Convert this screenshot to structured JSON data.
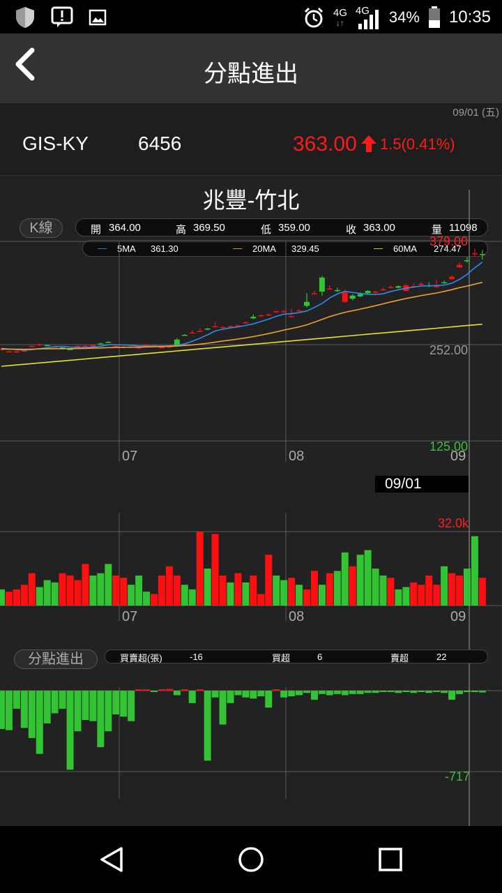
{
  "status_bar": {
    "network_1": "4G",
    "network_2": "4G",
    "battery": "34%",
    "time": "10:35",
    "icons": [
      "shield-icon",
      "alert-icon",
      "image-icon",
      "alarm-icon",
      "signal-icon",
      "battery-icon"
    ]
  },
  "header": {
    "title": "分點進出"
  },
  "quote": {
    "date": "09/01 (五)",
    "name": "GIS-KY",
    "code": "6456",
    "price": "363.00",
    "change": "1.5(0.41%)",
    "up_color": "#ff1a1a"
  },
  "broker": "兆豐-竹北",
  "kline": {
    "tag": "K線",
    "open_label": "開",
    "open": "364.00",
    "high_label": "高",
    "high": "369.50",
    "low_label": "低",
    "low": "359.00",
    "close_label": "收",
    "close": "363.00",
    "vol_label": "量",
    "vol": "11098",
    "ma5_label": "5MA",
    "ma5": "361.30",
    "ma5_color": "#2b8cf0",
    "ma20_label": "20MA",
    "ma20": "329.45",
    "ma20_color": "#f0a030",
    "ma60_label": "60MA",
    "ma60": "274.47",
    "ma60_color": "#e8e030",
    "y_high": "379.00",
    "y_mid": "252.00",
    "y_low": "125.00",
    "months": [
      "07",
      "08",
      "09"
    ],
    "cursor_date": "09/01"
  },
  "volume": {
    "max_label": "32.0k",
    "months": [
      "07",
      "08",
      "09"
    ]
  },
  "broker_flow": {
    "tag": "分點進出",
    "net_label": "買賣超(張)",
    "net": "-16",
    "buy_label": "買超",
    "buy": "6",
    "sell_label": "賣超",
    "sell": "22",
    "min_label": "-717"
  },
  "chart_data": [
    {
      "type": "candlestick",
      "title": "K線",
      "ylim": [
        125,
        379
      ],
      "y_ticks": [
        125,
        252,
        379
      ],
      "x_ticks": [
        "07",
        "08",
        "09"
      ],
      "series": [
        {
          "name": "5MA",
          "last": 361.3
        },
        {
          "name": "20MA",
          "last": 329.45
        },
        {
          "name": "60MA",
          "last": 274.47
        }
      ],
      "candles": [
        [
          0,
          242,
          243,
          241,
          242
        ],
        [
          1,
          239,
          240,
          238,
          239
        ],
        [
          2,
          238,
          240,
          237,
          239
        ],
        [
          3,
          240,
          241,
          239,
          240
        ],
        [
          4,
          245,
          246,
          244,
          246
        ],
        [
          5,
          247,
          249,
          246,
          248
        ],
        [
          6,
          247,
          248,
          246,
          246
        ],
        [
          7,
          245,
          246,
          244,
          245
        ],
        [
          8,
          244,
          244,
          241,
          242
        ],
        [
          9,
          242,
          243,
          241,
          241
        ],
        [
          10,
          243,
          246,
          243,
          246
        ],
        [
          11,
          245,
          247,
          244,
          246
        ],
        [
          12,
          245,
          248,
          244,
          247
        ],
        [
          13,
          249,
          250,
          248,
          248
        ],
        [
          14,
          251,
          252,
          250,
          250
        ],
        [
          15,
          246,
          246,
          244,
          246
        ],
        [
          16,
          244,
          246,
          243,
          245
        ],
        [
          17,
          244,
          246,
          243,
          245
        ],
        [
          18,
          244,
          246,
          242,
          244
        ],
        [
          19,
          246,
          248,
          245,
          248
        ],
        [
          20,
          246,
          247,
          244,
          247
        ],
        [
          21,
          243,
          245,
          243,
          245
        ],
        [
          22,
          244,
          246,
          243,
          246
        ],
        [
          23,
          254,
          256,
          245,
          246
        ],
        [
          24,
          260,
          261,
          259,
          259
        ],
        [
          25,
          262,
          266,
          262,
          263
        ],
        [
          26,
          264,
          268,
          264,
          265
        ],
        [
          27,
          268,
          269,
          266,
          267
        ],
        [
          28,
          270,
          276,
          270,
          271
        ],
        [
          29,
          269,
          271,
          268,
          270
        ],
        [
          30,
          270,
          272,
          269,
          271
        ],
        [
          31,
          272,
          273,
          271,
          272
        ],
        [
          32,
          275,
          277,
          275,
          276
        ],
        [
          33,
          283,
          286,
          280,
          281
        ],
        [
          34,
          284,
          286,
          283,
          285
        ],
        [
          35,
          285,
          287,
          284,
          286
        ],
        [
          36,
          289,
          291,
          288,
          290
        ],
        [
          37,
          290,
          292,
          289,
          290
        ],
        [
          38,
          283,
          293,
          285,
          284
        ],
        [
          39,
          291,
          293,
          290,
          291
        ],
        [
          40,
          302,
          313,
          295,
          297
        ],
        [
          41,
          312,
          316,
          312,
          313
        ],
        [
          42,
          333,
          335,
          310,
          315
        ],
        [
          43,
          319,
          323,
          318,
          319
        ],
        [
          44,
          317,
          320,
          315,
          316
        ],
        [
          45,
          302,
          318,
          301,
          314
        ],
        [
          46,
          310,
          312,
          304,
          306
        ],
        [
          47,
          312,
          314,
          308,
          309
        ],
        [
          48,
          316,
          317,
          312,
          313
        ],
        [
          49,
          314,
          316,
          313,
          315
        ],
        [
          50,
          318,
          320,
          316,
          318
        ],
        [
          51,
          321,
          323,
          319,
          321
        ],
        [
          52,
          322,
          323,
          319,
          320
        ],
        [
          53,
          316,
          325,
          315,
          323
        ],
        [
          54,
          322,
          326,
          320,
          322
        ],
        [
          55,
          324,
          327,
          322,
          325
        ],
        [
          56,
          323,
          327,
          321,
          322
        ],
        [
          57,
          321,
          330,
          320,
          322
        ],
        [
          58,
          327,
          329,
          325,
          326
        ],
        [
          59,
          331,
          336,
          330,
          334
        ],
        [
          60,
          346,
          352,
          345,
          349
        ],
        [
          61,
          355,
          359,
          352,
          354
        ],
        [
          62,
          363,
          369.5,
          359,
          364
        ],
        [
          63,
          363,
          368,
          356,
          362
        ]
      ]
    },
    {
      "type": "bar",
      "title": "volume",
      "ymax_label": "32.0k",
      "x_ticks": [
        "07",
        "08",
        "09"
      ],
      "values": [
        [
          0,
          7,
          0
        ],
        [
          1,
          6,
          1
        ],
        [
          2,
          7,
          1
        ],
        [
          3,
          9,
          1
        ],
        [
          4,
          14,
          1
        ],
        [
          5,
          8,
          0
        ],
        [
          6,
          11,
          0
        ],
        [
          7,
          10,
          0
        ],
        [
          8,
          14,
          1
        ],
        [
          9,
          13,
          1
        ],
        [
          10,
          11,
          1
        ],
        [
          11,
          18,
          1
        ],
        [
          12,
          13,
          0
        ],
        [
          13,
          14,
          0
        ],
        [
          14,
          18,
          0
        ],
        [
          15,
          13,
          1
        ],
        [
          16,
          12,
          1
        ],
        [
          17,
          9,
          0
        ],
        [
          18,
          13,
          0
        ],
        [
          19,
          6,
          0
        ],
        [
          20,
          5,
          1
        ],
        [
          21,
          13,
          1
        ],
        [
          22,
          17,
          1
        ],
        [
          23,
          13,
          1
        ],
        [
          24,
          9,
          0
        ],
        [
          25,
          7,
          0
        ],
        [
          26,
          32,
          1
        ],
        [
          27,
          16,
          0
        ],
        [
          28,
          31,
          1
        ],
        [
          29,
          13,
          1
        ],
        [
          30,
          10,
          0
        ],
        [
          31,
          14,
          1
        ],
        [
          32,
          10,
          0
        ],
        [
          33,
          13,
          1
        ],
        [
          34,
          5,
          1
        ],
        [
          35,
          22,
          1
        ],
        [
          36,
          13,
          0
        ],
        [
          37,
          11,
          0
        ],
        [
          38,
          12,
          1
        ],
        [
          39,
          9,
          0
        ],
        [
          40,
          7,
          1
        ],
        [
          41,
          15,
          1
        ],
        [
          42,
          9,
          0
        ],
        [
          43,
          14,
          1
        ],
        [
          44,
          15,
          0
        ],
        [
          45,
          23,
          0
        ],
        [
          46,
          17,
          1
        ],
        [
          47,
          22,
          0
        ],
        [
          48,
          24,
          0
        ],
        [
          49,
          16,
          0
        ],
        [
          50,
          13,
          0
        ],
        [
          51,
          12,
          1
        ],
        [
          52,
          7,
          0
        ],
        [
          53,
          8,
          0
        ],
        [
          54,
          10,
          1
        ],
        [
          55,
          9,
          1
        ],
        [
          56,
          13,
          1
        ],
        [
          57,
          9,
          1
        ],
        [
          58,
          17,
          0
        ],
        [
          59,
          14,
          1
        ],
        [
          60,
          13,
          1
        ],
        [
          61,
          16,
          0
        ],
        [
          62,
          30,
          0
        ],
        [
          63,
          12,
          1
        ]
      ]
    },
    {
      "type": "bar",
      "title": "分點進出",
      "ymin_label": "-717",
      "x_ticks": [
        "07",
        "08",
        "09"
      ],
      "values": [
        [
          0,
          -340
        ],
        [
          1,
          -350
        ],
        [
          2,
          -160
        ],
        [
          3,
          -330
        ],
        [
          4,
          -420
        ],
        [
          5,
          -560
        ],
        [
          6,
          -290
        ],
        [
          7,
          -200
        ],
        [
          8,
          -160
        ],
        [
          9,
          -700
        ],
        [
          10,
          -360
        ],
        [
          11,
          -260
        ],
        [
          12,
          -270
        ],
        [
          13,
          -500
        ],
        [
          14,
          -360
        ],
        [
          15,
          -210
        ],
        [
          16,
          -230
        ],
        [
          17,
          -270
        ],
        [
          18,
          0
        ],
        [
          19,
          0
        ],
        [
          20,
          -10
        ],
        [
          21,
          0
        ],
        [
          22,
          15
        ],
        [
          23,
          -40
        ],
        [
          24,
          0
        ],
        [
          25,
          -110
        ],
        [
          26,
          0
        ],
        [
          27,
          -620
        ],
        [
          28,
          -60
        ],
        [
          29,
          -300
        ],
        [
          30,
          -110
        ],
        [
          31,
          -40
        ],
        [
          32,
          -60
        ],
        [
          33,
          -70
        ],
        [
          34,
          -50
        ],
        [
          35,
          -150
        ],
        [
          36,
          0
        ],
        [
          37,
          -60
        ],
        [
          38,
          -50
        ],
        [
          39,
          -40
        ],
        [
          40,
          -20
        ],
        [
          41,
          -80
        ],
        [
          42,
          -30
        ],
        [
          43,
          -40
        ],
        [
          44,
          -30
        ],
        [
          45,
          -40
        ],
        [
          46,
          -30
        ],
        [
          47,
          -30
        ],
        [
          48,
          -20
        ],
        [
          49,
          -20
        ],
        [
          50,
          -10
        ],
        [
          51,
          -10
        ],
        [
          52,
          -20
        ],
        [
          53,
          -10
        ],
        [
          54,
          -20
        ],
        [
          55,
          -10
        ],
        [
          56,
          -20
        ],
        [
          57,
          -10
        ],
        [
          58,
          -20
        ],
        [
          59,
          -80
        ],
        [
          60,
          -30
        ],
        [
          61,
          -10
        ],
        [
          62,
          -10
        ],
        [
          63,
          -16
        ]
      ]
    }
  ]
}
